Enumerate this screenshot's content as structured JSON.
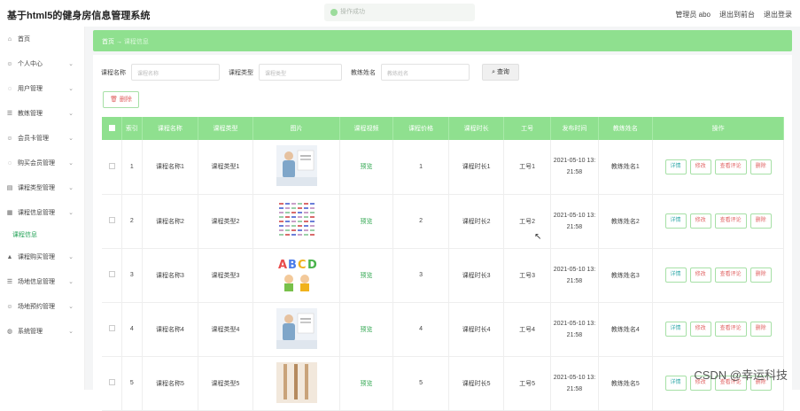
{
  "app": {
    "title": "基于html5的健身房信息管理系统"
  },
  "toast": {
    "text": "操作成功"
  },
  "header": {
    "admin": "管理员 abo",
    "front": "退出到前台",
    "logout": "退出登录"
  },
  "sidebar": {
    "items": [
      {
        "label": "首页",
        "icon": "home-icon",
        "glyph": "⌂",
        "chevron": false
      },
      {
        "label": "个人中心",
        "icon": "user-icon",
        "glyph": "☺",
        "chevron": true
      },
      {
        "label": "用户管理",
        "icon": "users-icon",
        "glyph": "◌",
        "chevron": true
      },
      {
        "label": "教练管理",
        "icon": "coach-icon",
        "glyph": "☰",
        "chevron": true
      },
      {
        "label": "会员卡管理",
        "icon": "card-icon",
        "glyph": "☺",
        "chevron": true
      },
      {
        "label": "购买会员管理",
        "icon": "buy-icon",
        "glyph": "◌",
        "chevron": true
      },
      {
        "label": "课程类型管理",
        "icon": "type-icon",
        "glyph": "▤",
        "chevron": true
      },
      {
        "label": "课程信息管理",
        "icon": "course-icon",
        "glyph": "▦",
        "chevron": true
      },
      {
        "label": "课程购买管理",
        "icon": "purchase-icon",
        "glyph": "▲",
        "chevron": true
      },
      {
        "label": "场地信息管理",
        "icon": "venue-icon",
        "glyph": "☰",
        "chevron": true
      },
      {
        "label": "场地预约管理",
        "icon": "booking-icon",
        "glyph": "☺",
        "chevron": true
      },
      {
        "label": "系统管理",
        "icon": "system-icon",
        "glyph": "◍",
        "chevron": true
      }
    ],
    "sub_item": "课程信息"
  },
  "breadcrumb": {
    "home": "首页",
    "sep": "→",
    "current": "课程信息"
  },
  "search": {
    "name_label": "课程名称",
    "name_placeholder": "课程名称",
    "type_label": "课程类型",
    "type_placeholder": "课程类型",
    "coach_label": "教练姓名",
    "coach_placeholder": "教练姓名",
    "query": "查询"
  },
  "actions": {
    "delete": "删除"
  },
  "table": {
    "headers": [
      "",
      "索引",
      "课程名称",
      "课程类型",
      "图片",
      "课程视频",
      "课程价格",
      "课程时长",
      "工号",
      "发布时间",
      "教练姓名",
      "操作"
    ],
    "rows": [
      {
        "index": "1",
        "name": "课程名称1",
        "type": "课程类型1",
        "image": "img-a",
        "video": "预览",
        "price": "1",
        "duration": "课程时长1",
        "job": "工号1",
        "date1": "2021-05-10 13:",
        "date2": "21:58",
        "coach": "教练姓名1"
      },
      {
        "index": "2",
        "name": "课程名称2",
        "type": "课程类型2",
        "image": "img-b",
        "video": "预览",
        "price": "2",
        "duration": "课程时长2",
        "job": "工号2",
        "date1": "2021-05-10 13:",
        "date2": "21:58",
        "coach": "教练姓名2"
      },
      {
        "index": "3",
        "name": "课程名称3",
        "type": "课程类型3",
        "image": "img-c",
        "video": "预览",
        "price": "3",
        "duration": "课程时长3",
        "job": "工号3",
        "date1": "2021-05-10 13:",
        "date2": "21:58",
        "coach": "教练姓名3"
      },
      {
        "index": "4",
        "name": "课程名称4",
        "type": "课程类型4",
        "image": "img-a",
        "video": "预览",
        "price": "4",
        "duration": "课程时长4",
        "job": "工号4",
        "date1": "2021-05-10 13:",
        "date2": "21:58",
        "coach": "教练姓名4"
      },
      {
        "index": "5",
        "name": "课程名称5",
        "type": "课程类型5",
        "image": "img-d",
        "video": "预览",
        "price": "5",
        "duration": "课程时长5",
        "job": "工号5",
        "date1": "2021-05-10 13:",
        "date2": "21:58",
        "coach": "教练姓名5"
      }
    ],
    "ops": {
      "detail": "详情",
      "edit": "修改",
      "review": "查看评论",
      "delete": "删除"
    }
  },
  "watermark": "CSDN @幸运科技",
  "colors": {
    "accent": "#8fe08f",
    "danger": "#e06363",
    "link": "#34a853"
  }
}
